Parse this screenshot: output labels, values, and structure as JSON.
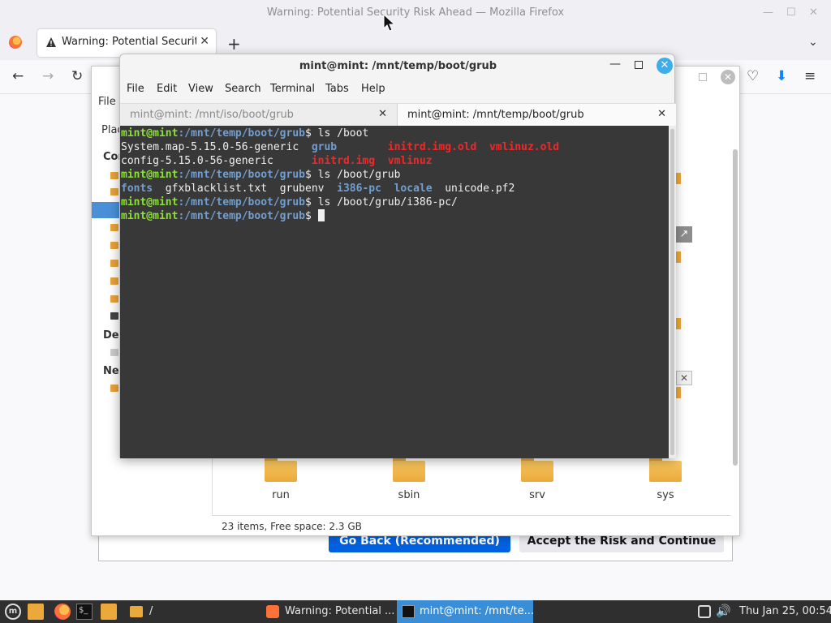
{
  "firefox": {
    "window_title": "Warning: Potential Security Risk Ahead — Mozilla Firefox",
    "tab_label": "Warning: Potential Security Risk Ahead",
    "tab_close": "✕",
    "new_tab": "+",
    "list_tabs": "⌄",
    "win_min": "—",
    "win_max": "☐",
    "win_close": "✕",
    "nav": {
      "back": "←",
      "forward": "→",
      "reload": "↻",
      "page_close": "✕",
      "pocket": "♡",
      "downloads": "⬇",
      "menu": "≡"
    },
    "go_back_label": "Go Back (Recommended)",
    "accept_label": "Accept the Risk and Continue"
  },
  "file_manager": {
    "menu_file": "File",
    "places_label": "Plac",
    "sidebar_computer": "Cor",
    "sidebar_devices": "Dev",
    "sidebar_network": "Net",
    "folders": [
      {
        "label": "run"
      },
      {
        "label": "sbin"
      },
      {
        "label": "srv"
      },
      {
        "label": "sys"
      }
    ],
    "status": "23 items, Free space: 2.3 GB",
    "close": "✕",
    "fullscreen": "↗",
    "close_small": "✕"
  },
  "terminal": {
    "title": "mint@mint: /mnt/temp/boot/grub",
    "min": "—",
    "close": "✕",
    "menu": [
      "File",
      "Edit",
      "View",
      "Search",
      "Terminal",
      "Tabs",
      "Help"
    ],
    "tabs": [
      {
        "label": "mint@mint: /mnt/iso/boot/grub",
        "close": "✕"
      },
      {
        "label": "mint@mint: /mnt/temp/boot/grub",
        "close": "✕"
      }
    ],
    "prompt_user": "mint@mint",
    "prompt_path": ":/mnt/temp/boot/grub",
    "prompt_sign": "$ ",
    "cmd1": "ls /boot",
    "out1": {
      "a1": "System.map-5.15.0-56-generic",
      "a2": "grub",
      "a3": "initrd.img.old",
      "a4": "vmlinuz.old",
      "b1": "config-5.15.0-56-generic",
      "b2": "initrd.img",
      "b3": "vmlinuz"
    },
    "cmd2": "ls /boot/grub",
    "out2": {
      "c1": "fonts",
      "c2": "gfxblacklist.txt",
      "c3": "grubenv",
      "c4": "i386-pc",
      "c5": "locale",
      "c6": "unicode.pf2"
    },
    "cmd3": "ls /boot/grub/i386-pc/"
  },
  "taskbar": {
    "menu_icon": "m",
    "terminal_icon": "$_",
    "path_label": "/",
    "task_firefox": "Warning: Potential ...",
    "task_terminal": "mint@mint: /mnt/te...",
    "volume": "🔊",
    "clock": "Thu Jan 25, 00:54"
  }
}
